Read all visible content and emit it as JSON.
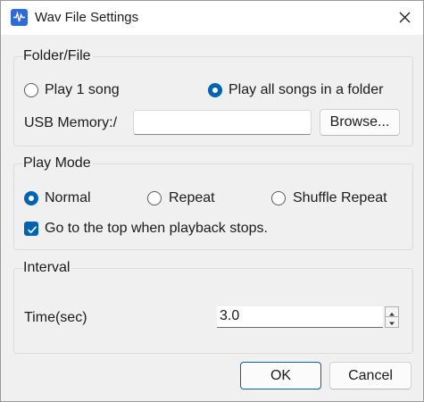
{
  "window": {
    "title": "Wav File Settings",
    "icon": "app-icon",
    "close_icon": "close-icon"
  },
  "folder_file": {
    "group_title": "Folder/File",
    "options": [
      {
        "label": "Play 1 song",
        "selected": false
      },
      {
        "label": "Play all songs in a folder",
        "selected": true
      }
    ],
    "usb_label": "USB Memory:/",
    "usb_value": "",
    "browse_label": "Browse..."
  },
  "play_mode": {
    "group_title": "Play Mode",
    "options": [
      {
        "label": "Normal",
        "selected": true
      },
      {
        "label": "Repeat",
        "selected": false
      },
      {
        "label": "Shuffle Repeat",
        "selected": false
      }
    ],
    "checkbox_label": "Go to the top when playback stops.",
    "checkbox_checked": true
  },
  "interval": {
    "group_title": "Interval",
    "time_label": "Time(sec)",
    "time_value": "3.0"
  },
  "footer": {
    "ok_label": "OK",
    "cancel_label": "Cancel"
  },
  "colors": {
    "accent": "#0063b1",
    "dialog_bg": "#f0f0f0",
    "titlebar_bg": "#ffffff"
  }
}
